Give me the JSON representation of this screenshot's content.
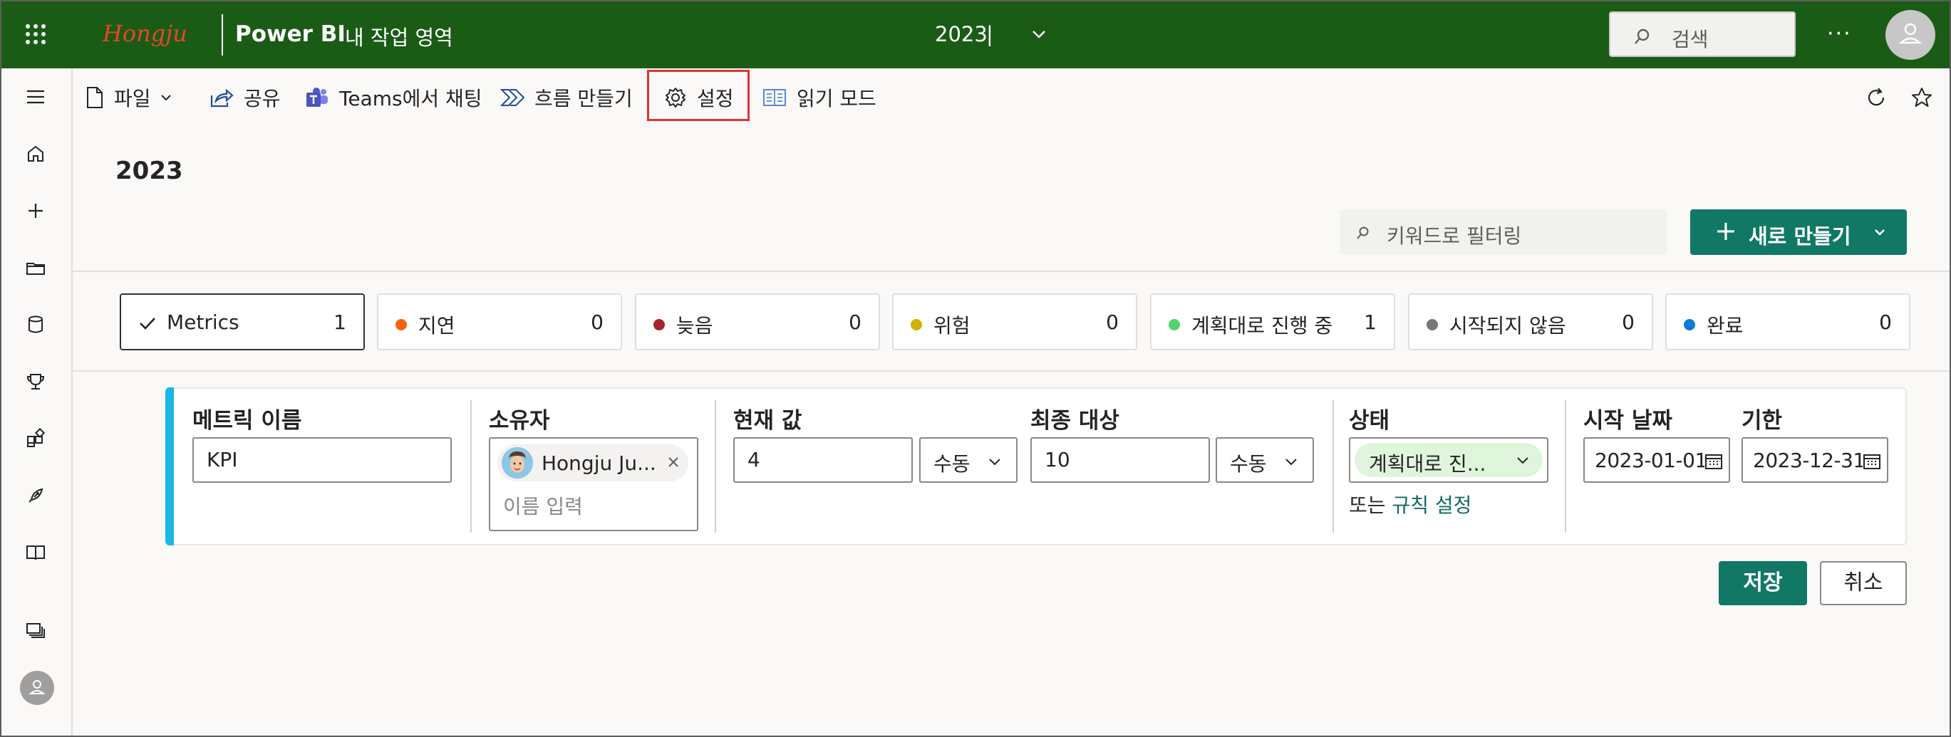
{
  "header": {
    "brand": "Hongju",
    "app_name": "Power BI",
    "workspace": "내 작업 영역",
    "report_title": "2023",
    "report_separator": "|",
    "search_placeholder": "검색",
    "more": "···",
    "colors": {
      "header_bg": "#1a5c16",
      "brand": "#e8442e"
    }
  },
  "rail": {
    "icons": [
      "menu-icon",
      "home-icon",
      "create-icon",
      "browse-icon",
      "data-hub-icon",
      "goals-icon",
      "apps-icon",
      "deployment-icon",
      "learn-icon",
      "workspaces-icon",
      "account-icon"
    ]
  },
  "toolbar": {
    "file": "파일",
    "share": "공유",
    "teams_chat": "Teams에서 채팅",
    "create_flow": "흐름 만들기",
    "settings": "설정",
    "reading_mode": "읽기 모드"
  },
  "page": {
    "title": "2023",
    "filter_placeholder": "키워드로 필터링",
    "new_button": "새로 만들기"
  },
  "status_cards": [
    {
      "label": "Metrics",
      "count": "1",
      "color": "",
      "selected": true
    },
    {
      "label": "지연",
      "count": "0",
      "color": "#f7630c"
    },
    {
      "label": "늦음",
      "count": "0",
      "color": "#a4262c"
    },
    {
      "label": "위험",
      "count": "0",
      "color": "#d1b000"
    },
    {
      "label": "계획대로 진행 중",
      "count": "1",
      "color": "#54d46a"
    },
    {
      "label": "시작되지 않음",
      "count": "0",
      "color": "#797775"
    },
    {
      "label": "완료",
      "count": "0",
      "color": "#0f7bd7"
    }
  ],
  "metric_form": {
    "name_header": "메트릭 이름",
    "name_value": "KPI",
    "owner_header": "소유자",
    "owner_name": "Hongju Ju...",
    "owner_placeholder": "이름 입력",
    "current_header": "현재 값",
    "current_value": "4",
    "current_mode": "수동",
    "target_header": "최종 대상",
    "target_value": "10",
    "target_mode": "수동",
    "status_header": "상태",
    "status_value": "계획대로 진...",
    "rule_prefix": "또는",
    "rule_link": "규칙 설정",
    "start_header": "시작 날짜",
    "start_value": "2023-01-01",
    "due_header": "기한",
    "due_value": "2023-12-31",
    "accent_color": "#1bb8e6"
  },
  "actions": {
    "save": "저장",
    "cancel": "취소",
    "primary_color": "#117865"
  }
}
